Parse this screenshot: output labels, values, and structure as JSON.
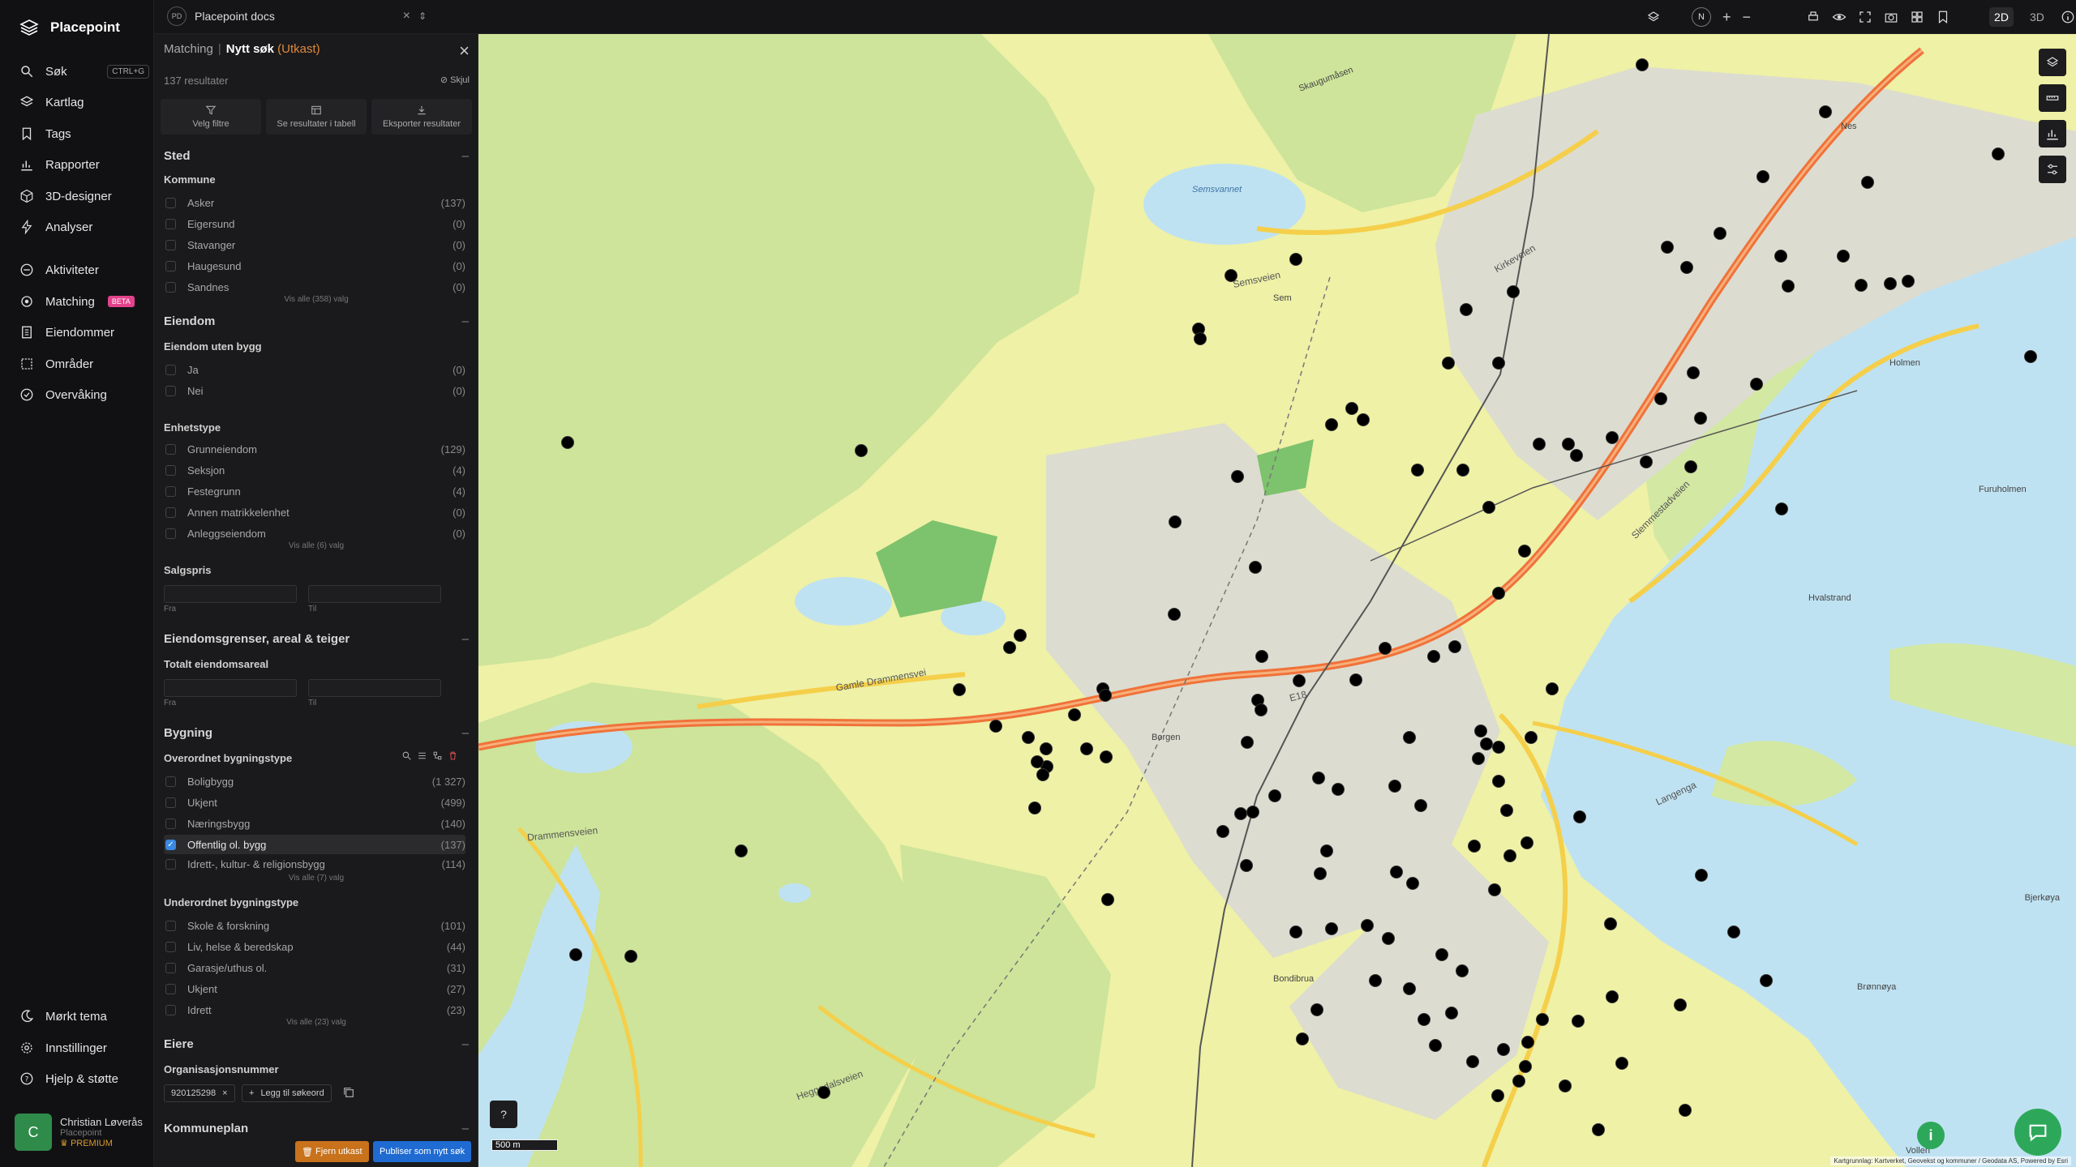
{
  "app": {
    "name": "Placepoint",
    "nav": [
      {
        "label": "Søk",
        "icon": "search-icon",
        "shortcut": "CTRL+G"
      },
      {
        "label": "Kartlag",
        "icon": "layers-icon"
      },
      {
        "label": "Tags",
        "icon": "bookmark-icon"
      },
      {
        "label": "Rapporter",
        "icon": "chart-icon"
      },
      {
        "label": "3D-designer",
        "icon": "cube-icon"
      },
      {
        "label": "Analyser",
        "icon": "lightning-icon"
      },
      {
        "label": "Aktiviteter",
        "icon": "activity-icon"
      },
      {
        "label": "Matching",
        "icon": "target-icon",
        "badge": "BETA"
      },
      {
        "label": "Eiendommer",
        "icon": "building-icon"
      },
      {
        "label": "Områder",
        "icon": "area-icon"
      },
      {
        "label": "Overvåking",
        "icon": "monitor-icon"
      }
    ],
    "bottom_nav": [
      {
        "label": "Mørkt tema",
        "icon": "moon-icon"
      },
      {
        "label": "Innstillinger",
        "icon": "gear-icon"
      },
      {
        "label": "Hjelp & støtte",
        "icon": "help-icon"
      }
    ],
    "user": {
      "initial": "C",
      "name": "Christian Løverås",
      "org": "Placepoint",
      "plan": "PREMIUM"
    }
  },
  "topbar": {
    "doc_badge": "PD",
    "doc_title": "Placepoint docs",
    "mode_2d": "2D",
    "mode_3d": "3D",
    "north": "N"
  },
  "panel": {
    "crumb": "Matching",
    "title": "Nytt søk",
    "status": "(Utkast)",
    "result_count": "137 resultater",
    "hide": "Skjul",
    "actions": [
      "Velg filtre",
      "Se resultater i tabell",
      "Eksporter resultater"
    ],
    "sections": {
      "sted": "Sted",
      "eiendom": "Eiendom",
      "grenser": "Eiendomsgrenser, areal & teiger",
      "bygning": "Bygning",
      "eiere": "Eiere",
      "kommuneplan": "Kommuneplan"
    },
    "kommune": {
      "label": "Kommune",
      "items": [
        {
          "name": "Asker",
          "count": "(137)"
        },
        {
          "name": "Eigersund",
          "count": "(0)"
        },
        {
          "name": "Stavanger",
          "count": "(0)"
        },
        {
          "name": "Haugesund",
          "count": "(0)"
        },
        {
          "name": "Sandnes",
          "count": "(0)"
        }
      ],
      "see_all": "Vis alle (358) valg"
    },
    "uten_bygg": {
      "label": "Eiendom uten bygg",
      "items": [
        {
          "name": "Ja",
          "count": "(0)"
        },
        {
          "name": "Nei",
          "count": "(0)"
        }
      ]
    },
    "enhetstype": {
      "label": "Enhetstype",
      "items": [
        {
          "name": "Grunneiendom",
          "count": "(129)"
        },
        {
          "name": "Seksjon",
          "count": "(4)"
        },
        {
          "name": "Festegrunn",
          "count": "(4)"
        },
        {
          "name": "Annen matrikkelenhet",
          "count": "(0)"
        },
        {
          "name": "Anleggseiendom",
          "count": "(0)"
        }
      ],
      "see_all": "Vis alle (6) valg"
    },
    "salgspris": {
      "label": "Salgspris",
      "from": "Fra",
      "to": "Til"
    },
    "areal": {
      "label": "Totalt eiendomsareal",
      "from": "Fra",
      "to": "Til"
    },
    "overordnet": {
      "label": "Overordnet bygningstype",
      "items": [
        {
          "name": "Boligbygg",
          "count": "(1 327)"
        },
        {
          "name": "Ukjent",
          "count": "(499)"
        },
        {
          "name": "Næringsbygg",
          "count": "(140)"
        },
        {
          "name": "Offentlig ol. bygg",
          "count": "(137)",
          "checked": true
        },
        {
          "name": "Idrett-, kultur- & religionsbygg",
          "count": "(114)"
        }
      ],
      "see_all": "Vis alle (7) valg"
    },
    "underordnet": {
      "label": "Underordnet bygningstype",
      "items": [
        {
          "name": "Skole & forskning",
          "count": "(101)"
        },
        {
          "name": "Liv, helse & beredskap",
          "count": "(44)"
        },
        {
          "name": "Garasje/uthus ol.",
          "count": "(31)"
        },
        {
          "name": "Ukjent",
          "count": "(27)"
        },
        {
          "name": "Idrett",
          "count": "(23)"
        }
      ],
      "see_all": "Vis alle (23) valg"
    },
    "org": {
      "label": "Organisasjonsnummer",
      "value": "920125298",
      "add": "Legg til søkeord"
    },
    "buttons": {
      "remove": "Fjern utkast",
      "publish": "Publiser som nytt søk"
    }
  },
  "map": {
    "scale": "500 m",
    "attribution": "Kartgrunnlag: Kartverket, Geovekst og kommuner / Geodata AS, Powered by Esri",
    "labels": [
      "Semsvannet",
      "Semsveien",
      "Sem",
      "Skaugumåsen",
      "Kirkeveien",
      "Slemmestadveien",
      "E18",
      "Gamle Drammensvei",
      "Drammensveien",
      "Heggedalsveien",
      "Langenga",
      "Hvalstrand",
      "Bjerkøya",
      "Brønnøya",
      "Vollen",
      "Borgen",
      "Bondibrua",
      "Nes",
      "Holmen",
      "Furuholmen"
    ]
  }
}
